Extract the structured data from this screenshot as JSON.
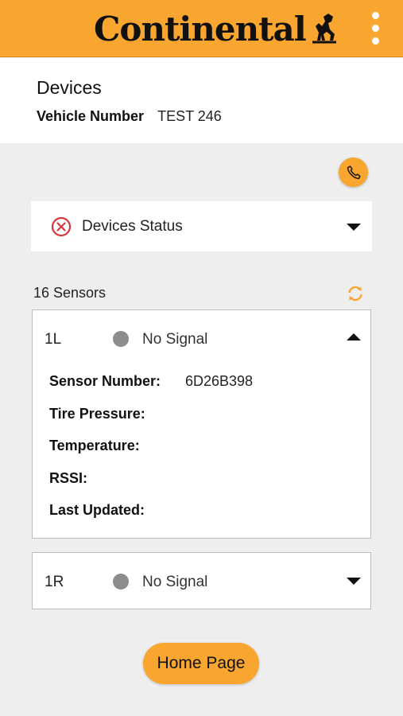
{
  "app": {
    "brand": "Continental",
    "brand_icon": "horse-logo-icon",
    "menu_icon": "more-vertical-icon",
    "accent_color": "#f9a630"
  },
  "header": {
    "title": "Devices",
    "vehicle_label": "Vehicle Number",
    "vehicle_value": "TEST 246"
  },
  "actions": {
    "call_icon": "phone-icon",
    "refresh_icon": "refresh-icon"
  },
  "status": {
    "label": "Devices Status",
    "icon": "error-circle-icon",
    "icon_color": "#d9363e"
  },
  "sensors": {
    "count_label": "16 Sensors",
    "items": [
      {
        "position": "1L",
        "signal": "No Signal",
        "expanded": true,
        "details": [
          {
            "label": "Sensor Number:",
            "value": "6D26B398"
          },
          {
            "label": "Tire Pressure:",
            "value": ""
          },
          {
            "label": "Temperature:",
            "value": ""
          },
          {
            "label": "RSSI:",
            "value": ""
          },
          {
            "label": "Last Updated:",
            "value": ""
          }
        ]
      },
      {
        "position": "1R",
        "signal": "No Signal",
        "expanded": false
      }
    ]
  },
  "footer": {
    "home_label": "Home Page"
  }
}
